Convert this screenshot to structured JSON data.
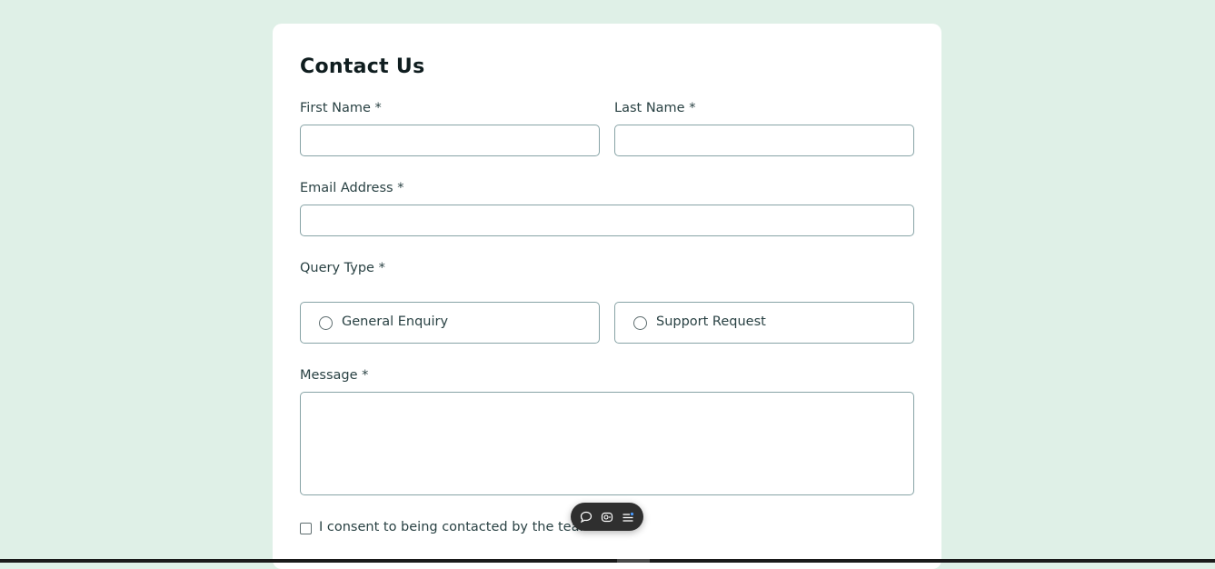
{
  "form": {
    "title": "Contact Us",
    "first_name_label": "First Name *",
    "first_name_value": "",
    "last_name_label": "Last Name *",
    "last_name_value": "",
    "email_label": "Email Address *",
    "email_value": "",
    "query_type_label": "Query Type *",
    "query_options": [
      "General Enquiry",
      "Support Request"
    ],
    "message_label": "Message *",
    "message_value": "",
    "consent_label": "I consent to being contacted by the team *"
  },
  "floating_toolbar": {
    "icons": [
      "comment-icon",
      "screenshot-icon",
      "menu-icon"
    ]
  },
  "colors": {
    "background": "#dff0e7",
    "card": "#ffffff",
    "border": "#87a3a6",
    "text": "#2a4244"
  }
}
